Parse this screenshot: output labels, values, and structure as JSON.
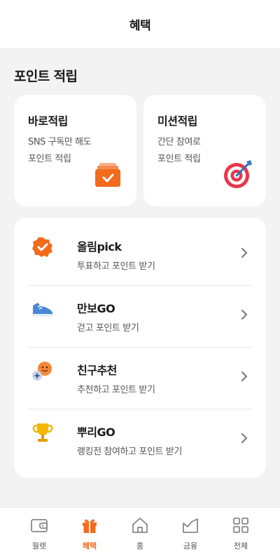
{
  "header": {
    "title": "혜택"
  },
  "section": {
    "title": "포인트 적립"
  },
  "cards": [
    {
      "title": "바로적립",
      "desc_line1": "SNS 구독만 해도",
      "desc_line2": "포인트 적립",
      "icon": "card-stack-check-icon"
    },
    {
      "title": "미션적립",
      "desc_line1": "간단 참여로",
      "desc_line2": "포인트 적립",
      "icon": "target-dart-icon"
    }
  ],
  "list": [
    {
      "title": "올림pick",
      "subtitle": "투표하고 포인트 받기",
      "icon": "badge-check-icon"
    },
    {
      "title": "만보GO",
      "subtitle": "걷고 포인트 받기",
      "icon": "sneaker-icon"
    },
    {
      "title": "친구추천",
      "subtitle": "추천하고 포인트 받기",
      "icon": "friend-add-icon"
    },
    {
      "title": "뿌리GO",
      "subtitle": "랭킹전 참여하고 포인트 받기",
      "icon": "trophy-icon"
    }
  ],
  "tabs": [
    {
      "label": "월렛",
      "icon": "wallet-icon",
      "active": false
    },
    {
      "label": "혜택",
      "icon": "gift-icon",
      "active": true
    },
    {
      "label": "홈",
      "icon": "home-icon",
      "active": false
    },
    {
      "label": "금융",
      "icon": "chart-icon",
      "active": false
    },
    {
      "label": "전체",
      "icon": "grid-icon",
      "active": false
    }
  ],
  "colors": {
    "accent": "#f26b1d",
    "background": "#f3f3f3",
    "card": "#ffffff"
  }
}
